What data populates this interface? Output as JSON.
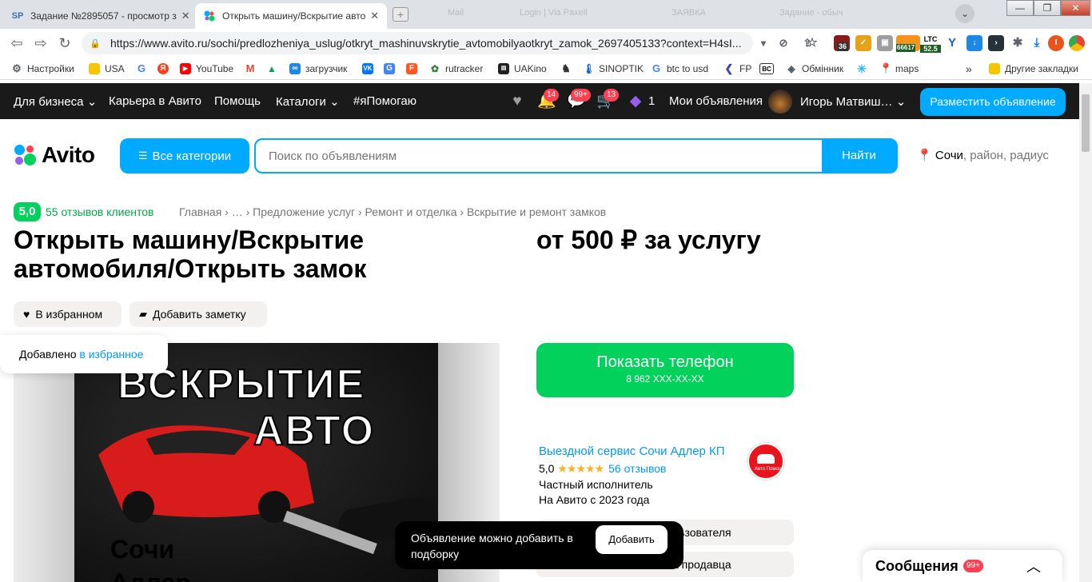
{
  "browser": {
    "tabs": [
      {
        "favicon": "SP",
        "title": "Задание №2895057 - просмотр з"
      },
      {
        "favicon": "avito-dots",
        "title": "Открыть машину/Вскрытие авто"
      }
    ],
    "ghost_tabs": [
      "Mail",
      "Login | Via Paxell",
      "ЗАЯВКА",
      "Задание - обыч"
    ],
    "new_tab_label": "+",
    "window_controls": {
      "minimize": "—",
      "restore": "❐",
      "close": "✕"
    },
    "url": "https://www.avito.ru/sochi/predlozheniya_uslug/otkryt_mashinuvskrytie_avtomobilyaotkryt_zamok_2697405133?context=H4sI...",
    "extensions": {
      "badge_36": "36",
      "price_66617": "66617",
      "ltc_label": "LTC",
      "ltc_value": "52.5",
      "profile_initial": "I"
    },
    "bookmarks": [
      {
        "icon": "gear-icon",
        "label": "Настройки"
      },
      {
        "icon": "folder-icon",
        "label": "USA"
      },
      {
        "icon": "google-icon",
        "label": ""
      },
      {
        "icon": "yandex-icon",
        "label": ""
      },
      {
        "icon": "youtube-icon",
        "label": "YouTube"
      },
      {
        "icon": "gmail-icon",
        "label": ""
      },
      {
        "icon": "drive-icon",
        "label": ""
      },
      {
        "icon": "link-icon",
        "label": "загрузчик"
      },
      {
        "icon": "vk-icon",
        "label": ""
      },
      {
        "icon": "translate-icon",
        "label": ""
      },
      {
        "icon": "f-icon",
        "label": ""
      },
      {
        "icon": "rutracker-icon",
        "label": "rutracker"
      },
      {
        "icon": "uakino-icon",
        "label": "UAKino"
      },
      {
        "icon": "chess-icon",
        "label": ""
      },
      {
        "icon": "thermometer-icon",
        "label": "SINOPTIK"
      },
      {
        "icon": "google-icon",
        "label": "btc to usd"
      },
      {
        "icon": "fp-icon",
        "label": "FP"
      },
      {
        "icon": "bc-icon",
        "label": ""
      },
      {
        "icon": "exchange-icon",
        "label": "Обмінник"
      },
      {
        "icon": "star-icon",
        "label": ""
      },
      {
        "icon": "maps-icon",
        "label": "maps"
      }
    ],
    "bookmarks_more": "»",
    "other_bookmarks": "Другие закладки"
  },
  "avito_header": {
    "links": [
      "Для бизнеса",
      "Карьера в Авито",
      "Помощь",
      "Каталоги",
      "#яПомогаю"
    ],
    "notifications_badge": "14",
    "messages_badge": "99+",
    "cart_badge": "13",
    "promo_count": "1",
    "my_ads": "Мои объявления",
    "user_name": "Игорь Матвиш…",
    "post_ad": "Разместить объявление"
  },
  "search": {
    "logo": "Avito",
    "categories": "Все категории",
    "placeholder": "Поиск по объявлениям",
    "button": "Найти",
    "location_city": "Сочи",
    "location_rest": ", район, радиус"
  },
  "listing": {
    "rating": "5,0",
    "reviews": "55 отзывов клиентов",
    "breadcrumbs": "Главная › … › Предложение услуг › Ремонт и отделка › Вскрытие и ремонт замков",
    "title": "Открыть машину/Вскрытие автомобиля/Открыть замок",
    "price": "от 500 ₽ за услугу",
    "fav_button": "В избранном",
    "note_button": "Добавить заметку",
    "fav_toast_prefix": "Добавлено ",
    "fav_toast_link": "в избранное",
    "photo_text": [
      "ВСКРЫТИЕ",
      "АВТО",
      "Сочи",
      "Адлер"
    ]
  },
  "contact": {
    "show_phone": "Показать телефон",
    "phone_masked": "8 962 XXX-XX-XX"
  },
  "seller": {
    "name": "Выездной сервис Сочи Адлер КП",
    "rating": "5,0",
    "stars": "★★★★★",
    "reviews": "56 отзывов",
    "type": "Частный исполнитель",
    "since": "На Авито с 2023 года",
    "logo_text": "Авто Помощь",
    "subscribe_partial": "льзователя",
    "other_ads_partial": "а продавца"
  },
  "snackbar": {
    "message": "Объявление можно добавить в подборку",
    "button": "Добавить"
  },
  "messenger": {
    "title": "Сообщения",
    "badge": "99+",
    "chevron": "︿"
  },
  "colors": {
    "avito_blue": "#00aaff",
    "avito_green": "#02d15c",
    "link_blue": "#0099f7",
    "badge_red": "#ff4053",
    "header_dark": "#1a1a1a"
  }
}
